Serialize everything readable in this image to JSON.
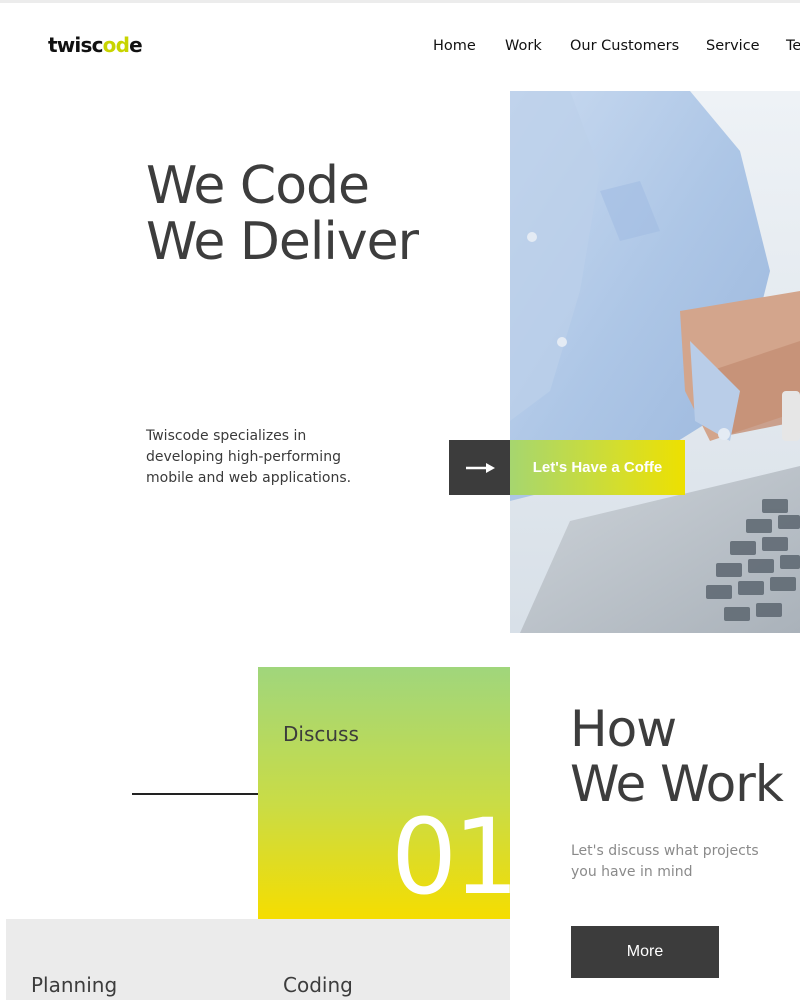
{
  "brand": {
    "logo_main": "twisc",
    "logo_accent": "od",
    "logo_end": "e"
  },
  "nav": {
    "items": [
      {
        "label": "Home"
      },
      {
        "label": "Work"
      },
      {
        "label": "Our Customers"
      },
      {
        "label": "Service"
      },
      {
        "label": "Te"
      }
    ]
  },
  "hero": {
    "title_line1": "We Code",
    "title_line2": "We Deliver",
    "description": "Twiscode specializes in developing high-performing mobile and web applications.",
    "cta_label": "Let's Have a Coffe",
    "image_icon": "office-laptop-photo"
  },
  "process": {
    "active_step": {
      "title": "Discuss",
      "number": "01"
    },
    "next_steps": [
      {
        "title": "Planning"
      },
      {
        "title": "Coding"
      }
    ]
  },
  "how": {
    "title_line1": "How",
    "title_line2": "We Work",
    "description": "Let's discuss what projects you have in mind",
    "button_label": "More"
  },
  "colors": {
    "accent_green": "#a6d66f",
    "accent_yellow": "#f5dd00",
    "dark": "#3c3c3c"
  }
}
